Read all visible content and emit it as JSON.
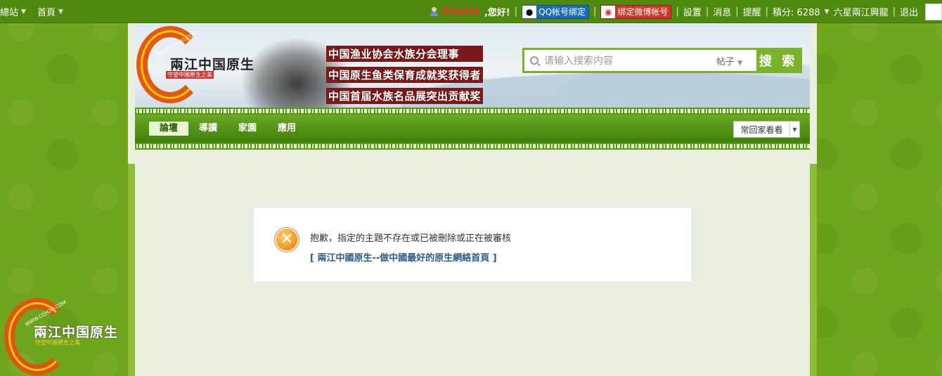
{
  "topbar": {
    "site_menu": "總站",
    "home_menu": "首頁",
    "username": "Dryzias",
    "greeting": ",您好!",
    "qq_bind": "QQ帐号绑定",
    "weibo_bind": "绑定微博帐号",
    "settings": "設置",
    "messages": "消息",
    "reminders": "提醒",
    "credits": "積分: 6288",
    "rank": "六星兩江興龍",
    "logout": "退出",
    "separator": "|"
  },
  "logo": {
    "title": "兩江中国原生",
    "tagline": "守望中國原生之美",
    "url": "WWW.CGH2O.COM"
  },
  "banner": {
    "honors": [
      "中国渔业协会水族分会理事",
      "中国原生鱼类保育成就奖获得者",
      "中国首届水族名品展突出贡献奖"
    ]
  },
  "search": {
    "placeholder": "请输入搜索内容",
    "type": "帖子",
    "button": "搜 索"
  },
  "nav": {
    "items": [
      "論壇",
      "導讀",
      "家園",
      "應用"
    ],
    "active_index": 0,
    "quick_select": "常回家看看"
  },
  "message": {
    "text": "抱歉，指定的主題不存在或已被刪除或正在被審核",
    "link": "[ 兩江中國原生--做中國最好的原生網絡首頁 ]"
  },
  "colors": {
    "topbar": "#4e8a0e",
    "navbar": "#3f7f0a",
    "page_bg": "#6ea51c",
    "content_bg": "#e9efdc",
    "link": "#2a5b8c"
  },
  "icons": {
    "error": "close-circle-icon",
    "search": "search-icon",
    "user": "user-icon",
    "qq": "qq-icon",
    "weibo": "weibo-icon"
  }
}
